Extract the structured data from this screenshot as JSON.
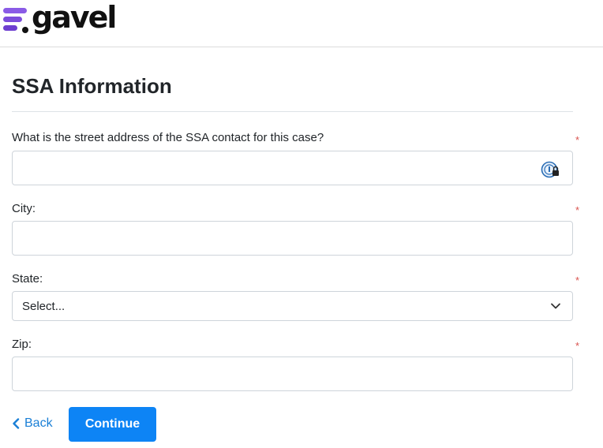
{
  "brand": {
    "name": "gavel",
    "accent": "#7c4ddb"
  },
  "page": {
    "title": "SSA Information"
  },
  "form": {
    "required_marker": "*",
    "street": {
      "label": "What is the street address of the SSA contact for this case?",
      "value": "",
      "placeholder": ""
    },
    "city": {
      "label": "City:",
      "value": "",
      "placeholder": ""
    },
    "state": {
      "label": "State:",
      "selected": "Select..."
    },
    "zip": {
      "label": "Zip:",
      "value": "",
      "placeholder": ""
    }
  },
  "nav": {
    "back_label": "Back",
    "continue_label": "Continue"
  },
  "colors": {
    "primary": "#0d84f5",
    "link": "#1a7fd6",
    "required": "#d9534f"
  },
  "icons": {
    "logo": "gavel-logo-icon",
    "password_manager": "password-manager-icon",
    "select_caret": "chevron-down-icon",
    "back": "chevron-left-icon"
  }
}
